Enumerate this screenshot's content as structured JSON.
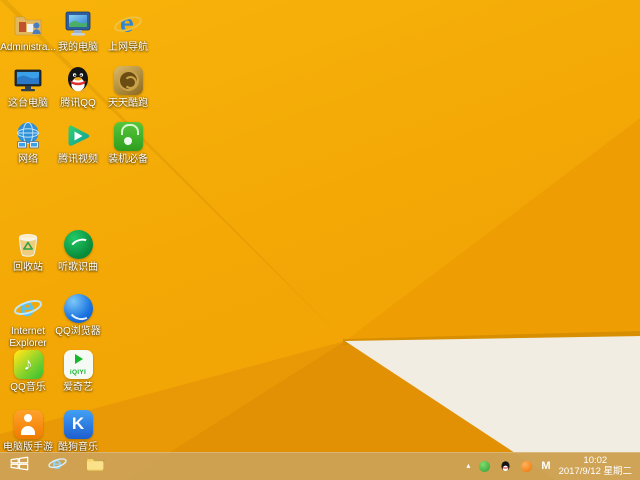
{
  "wallpaper": {
    "base_color": "#F2A606",
    "facet_dark": "#E29104",
    "facet_mid": "#E99905",
    "facet_upper": "#EE9E03",
    "white_facet": "#F2EDE2",
    "edge_line": "#D78E00"
  },
  "desktop": {
    "icons": [
      {
        "name": "administrator-user-files",
        "icon": "user-folder-icon",
        "label": "Administra..."
      },
      {
        "name": "my-computer",
        "icon": "crt-monitor-icon",
        "label": "我的电脑"
      },
      {
        "name": "web-navigation",
        "icon": "blue-e-icon",
        "label": "上网导航"
      },
      {
        "name": "this-pc",
        "icon": "flat-monitor-icon",
        "label": "这台电脑"
      },
      {
        "name": "tencent-qq",
        "icon": "penguin-icon",
        "label": "腾讯QQ"
      },
      {
        "name": "tiantian-game",
        "icon": "gold-emblem-icon",
        "label": "天天酷跑"
      },
      {
        "name": "network",
        "icon": "globe-icon",
        "label": "网络"
      },
      {
        "name": "tencent-video",
        "icon": "play-logo-icon",
        "label": "腾讯视频"
      },
      {
        "name": "essential-software",
        "icon": "green-bag-icon",
        "label": "装机必备"
      },
      {
        "name": "recycle-bin",
        "icon": "recycle-bin-icon",
        "label": "回收站"
      },
      {
        "name": "song-recognition",
        "icon": "green-circle-icon",
        "label": "听歌识曲"
      },
      {
        "name": "internet-explorer",
        "icon": "ie-e-icon",
        "label": "Internet Explorer"
      },
      {
        "name": "qq-browser",
        "icon": "blue-globe-swirl-icon",
        "label": "QQ浏览器"
      },
      {
        "name": "qq-music",
        "icon": "music-note-icon",
        "label": "QQ音乐"
      },
      {
        "name": "iqiyi",
        "icon": "iqiyi-logo-icon",
        "label": "爱奇艺"
      },
      {
        "name": "mobile-game-pc",
        "icon": "orange-figure-icon",
        "label": "电脑版手游"
      },
      {
        "name": "kugou-music",
        "icon": "blue-k-icon",
        "label": "酷狗音乐"
      }
    ],
    "iqiyi_wordmark": "iQIYI",
    "qq_music_note": "♪",
    "kugou_letter": "K"
  },
  "taskbar": {
    "start_button": {
      "icon": "windows-logo-icon"
    },
    "buttons": [
      {
        "name": "internet-explorer",
        "icon": "ie-e-icon"
      },
      {
        "name": "file-explorer",
        "icon": "folder-icon"
      }
    ],
    "tray": {
      "hidden_icons_chevron": "▴",
      "icons": [
        "antivirus-icon",
        "qq-penguin-icon",
        "alert-icon"
      ],
      "input_indicator": "M",
      "time": "10:02",
      "date": "2017/9/12 星期二"
    }
  }
}
